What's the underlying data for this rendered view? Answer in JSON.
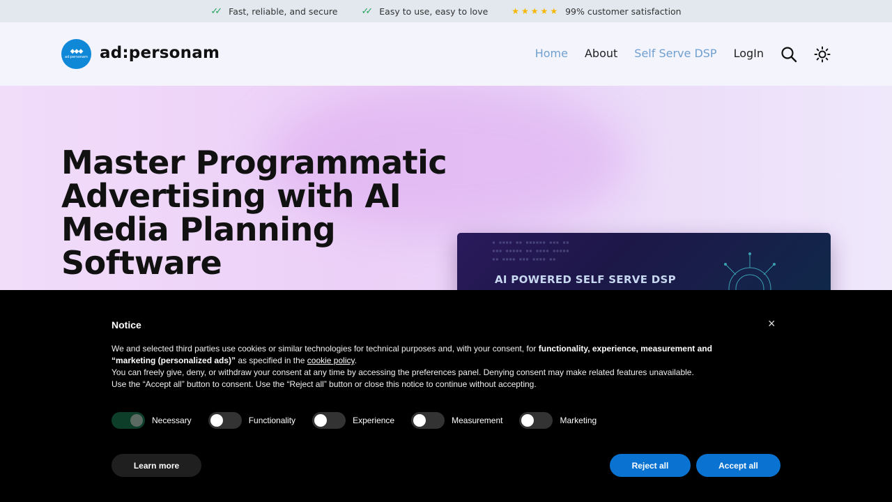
{
  "topbar": {
    "items": [
      {
        "text": "Fast, reliable, and secure",
        "icon": "double-check-icon"
      },
      {
        "text": "Easy to use, easy to love",
        "icon": "double-check-icon"
      },
      {
        "text": "99% customer satisfaction",
        "icon": "five-stars-icon"
      }
    ],
    "check_color": "#22a55b",
    "star_color": "#f5b700"
  },
  "header": {
    "logo_text": "ad:personam",
    "brand": "ad:personam",
    "nav": [
      {
        "label": "Home",
        "active": true
      },
      {
        "label": "About"
      },
      {
        "label": "Self Serve DSP"
      },
      {
        "label": "LogIn"
      }
    ],
    "accent": "#6fa0cf"
  },
  "hero": {
    "heading": "Master Programmatic Advertising with AI Media Planning Software",
    "card_title": "AI POWERED SELF SERVE DSP"
  },
  "notice": {
    "title": "Notice",
    "body_part1": "We and selected third parties use cookies or similar technologies for technical purposes and, with your consent, for ",
    "body_bold": "functionality, experience, measurement and “marketing (personalized ads)”",
    "body_part2": " as specified in the ",
    "cookie_link": "cookie policy",
    "body_part3": ".",
    "line2": "You can freely give, deny, or withdraw your consent at any time by accessing the preferences panel. Denying consent may make related features unavailable.",
    "line3": "Use the “Accept all” button to consent. Use the “Reject all” button or close this notice to continue without accepting.",
    "toggles": [
      {
        "label": "Necessary",
        "on": true
      },
      {
        "label": "Functionality",
        "on": false
      },
      {
        "label": "Experience",
        "on": false
      },
      {
        "label": "Measurement",
        "on": false
      },
      {
        "label": "Marketing",
        "on": false
      }
    ],
    "learn_more": "Learn more",
    "reject_all": "Reject all",
    "accept_all": "Accept all",
    "button_color": "#0a73d1"
  }
}
